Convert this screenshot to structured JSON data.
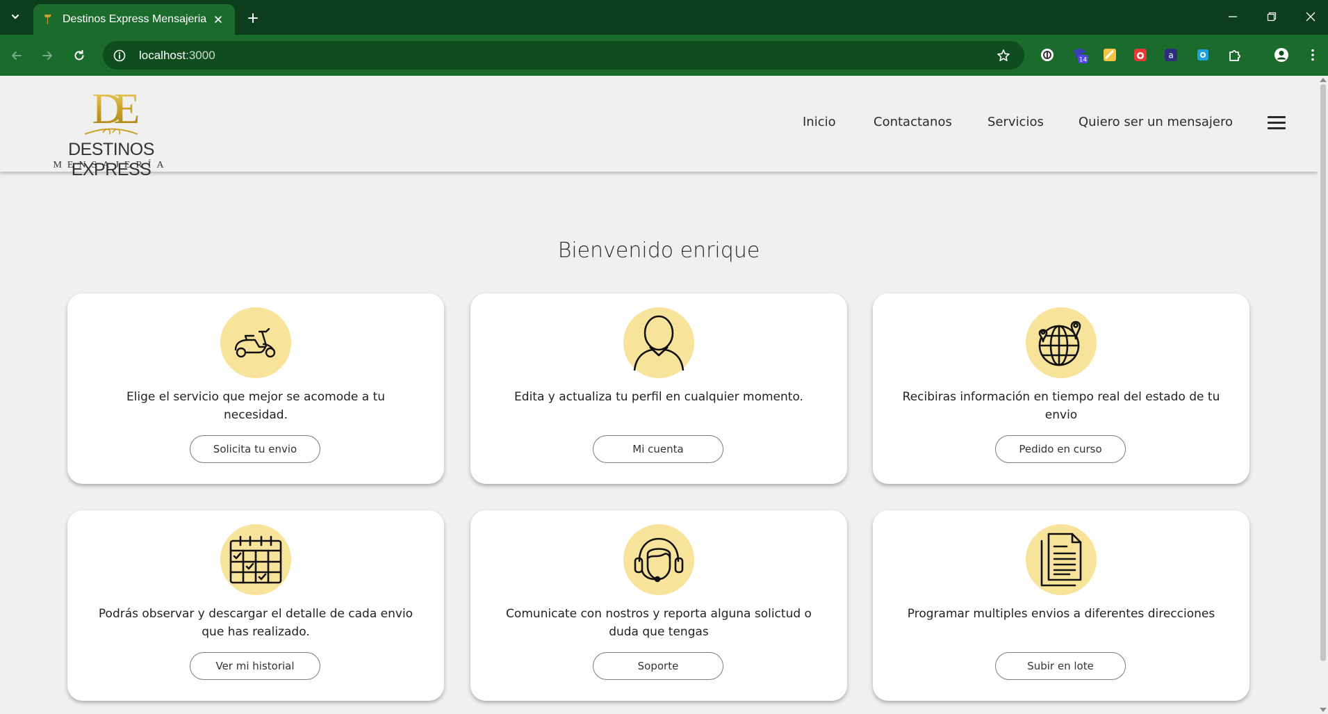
{
  "browser": {
    "tab_title": "Destinos Express Mensajeria",
    "url_host": "localhost",
    "url_port": ":3000",
    "extension_badge": "14",
    "theme_colors": {
      "frame": "#0c3d1c",
      "toolbar": "#1b6b2d",
      "omnibox": "#0f4d20"
    }
  },
  "site": {
    "logo": {
      "monogram": "DE",
      "name": "DESTINOS EXPRESS",
      "subtitle": "MENSAJERÍA"
    },
    "nav": {
      "inicio": "Inicio",
      "contactanos": "Contactanos",
      "servicios": "Servicios",
      "mensajero": "Quiero ser un mensajero"
    },
    "welcome": "Bienvenido enrique",
    "colors": {
      "icon_circle": "#f8e39b",
      "page_bg": "#f0f0f0",
      "logo_gold": "#c9a227"
    },
    "cards": [
      {
        "icon": "scooter-icon",
        "text": "Elige el servicio que mejor se acomode a tu necesidad.",
        "button": "Solicita tu envio"
      },
      {
        "icon": "user-profile-icon",
        "text": "Edita y actualiza tu perfil en cualquier momento.",
        "button": "Mi cuenta"
      },
      {
        "icon": "globe-location-icon",
        "text": "Recibiras información en tiempo real del estado de tu envio",
        "button": "Pedido en curso"
      },
      {
        "icon": "calendar-icon",
        "text": "Podrás observar y descargar el detalle de cada envio que has realizado.",
        "button": "Ver mi historial"
      },
      {
        "icon": "headset-support-icon",
        "text": "Comunicate con nostros y reporta alguna solictud o duda que tengas",
        "button": "Soporte"
      },
      {
        "icon": "document-icon",
        "text": "Programar multiples envios a diferentes direcciones",
        "button": "Subir en lote"
      }
    ]
  }
}
